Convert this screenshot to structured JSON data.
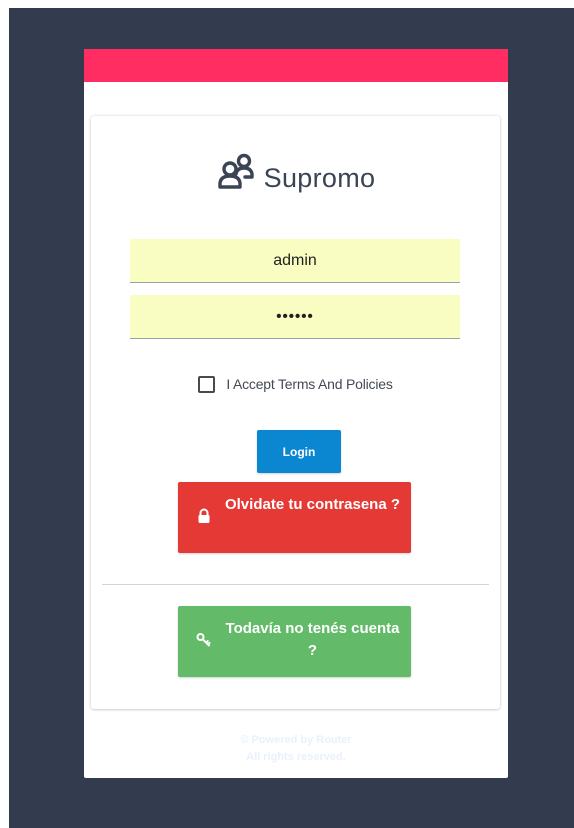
{
  "brand": {
    "name": "Supromo",
    "logo_icon": "users-icon",
    "color": "#3b4454"
  },
  "form": {
    "username_value": "admin",
    "password_value": "••••••",
    "terms_label": "I Accept Terms And Policies",
    "terms_checked": false
  },
  "buttons": {
    "login_label": "Login",
    "forgot_label": "Olvidate tu contrasena ?",
    "forgot_icon": "lock-icon",
    "register_label": "Todavía no tenés cuenta ?",
    "register_icon": "key-icon"
  },
  "footer": {
    "powered_by": "© Powered by Router",
    "rights": "All rights reserved."
  },
  "colors": {
    "background": "#333c4e",
    "accent_bar": "#ff2d61",
    "login": "#0b87d1",
    "forgot": "#e53935",
    "register": "#63bb6a",
    "input_fill": "#fafdc2"
  }
}
